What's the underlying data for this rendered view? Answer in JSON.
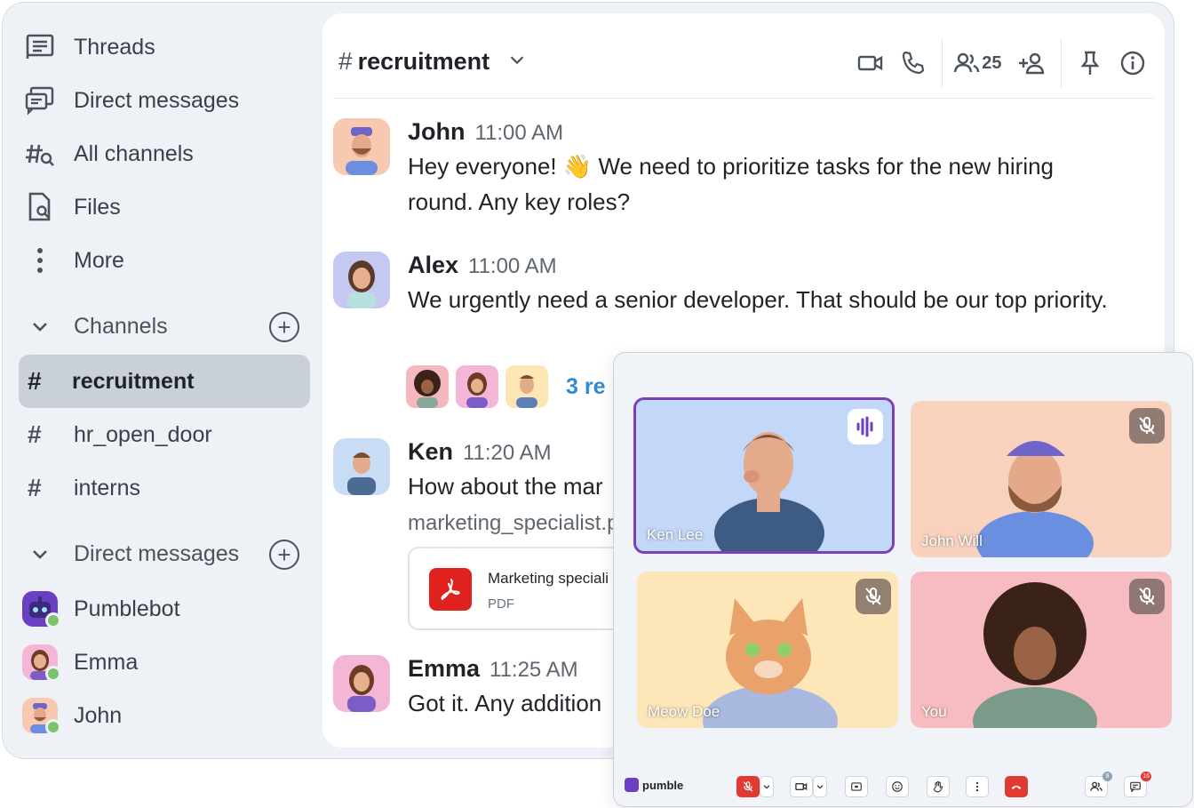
{
  "sidebar": {
    "nav": [
      {
        "label": "Threads",
        "icon": "threads-icon"
      },
      {
        "label": "Direct messages",
        "icon": "direct-messages-icon"
      },
      {
        "label": "All channels",
        "icon": "channel-search-icon"
      },
      {
        "label": "Files",
        "icon": "file-search-icon"
      },
      {
        "label": "More",
        "icon": "more-vertical-icon"
      }
    ],
    "channels_header": "Channels",
    "channels": [
      {
        "name": "recruitment",
        "active": true
      },
      {
        "name": "hr_open_door",
        "active": false
      },
      {
        "name": "interns",
        "active": false
      }
    ],
    "dm_header": "Direct messages",
    "dms": [
      {
        "name": "Pumblebot",
        "status": "online"
      },
      {
        "name": "Emma",
        "status": "online"
      },
      {
        "name": "John",
        "status": "online"
      }
    ]
  },
  "channel": {
    "hash": "#",
    "name": "recruitment",
    "member_count": "25"
  },
  "messages": [
    {
      "author": "John",
      "time": "11:00 AM",
      "text": "Hey everyone! 👋 We need to prioritize tasks for the new hiring round. Any key roles?"
    },
    {
      "author": "Alex",
      "time": "11:00 AM",
      "text": "We urgently need a senior developer. That should be our top priority."
    },
    {
      "author": "Ken",
      "time": "11:20 AM",
      "text": "How about the mar"
    },
    {
      "author": "Emma",
      "time": "11:25 AM",
      "text": "Got it. Any addition"
    }
  ],
  "reactions": {
    "replies_label": "3 re"
  },
  "attachment": {
    "filename": "marketing_specialist.p",
    "card_title": "Marketing speciali",
    "card_type": "PDF"
  },
  "call": {
    "participants": [
      {
        "name": "Ken Lee",
        "speaking": true,
        "muted": false
      },
      {
        "name": "John Will",
        "speaking": false,
        "muted": true
      },
      {
        "name": "Meow Doe",
        "speaking": false,
        "muted": true
      },
      {
        "name": "You",
        "speaking": false,
        "muted": true
      }
    ],
    "brand": "pumble",
    "participants_badge": "9",
    "chat_badge": "16"
  },
  "colors": {
    "accent": "#7b3fb8",
    "link": "#2e8bd8",
    "online": "#7ac36a",
    "end_call": "#e03a31"
  }
}
